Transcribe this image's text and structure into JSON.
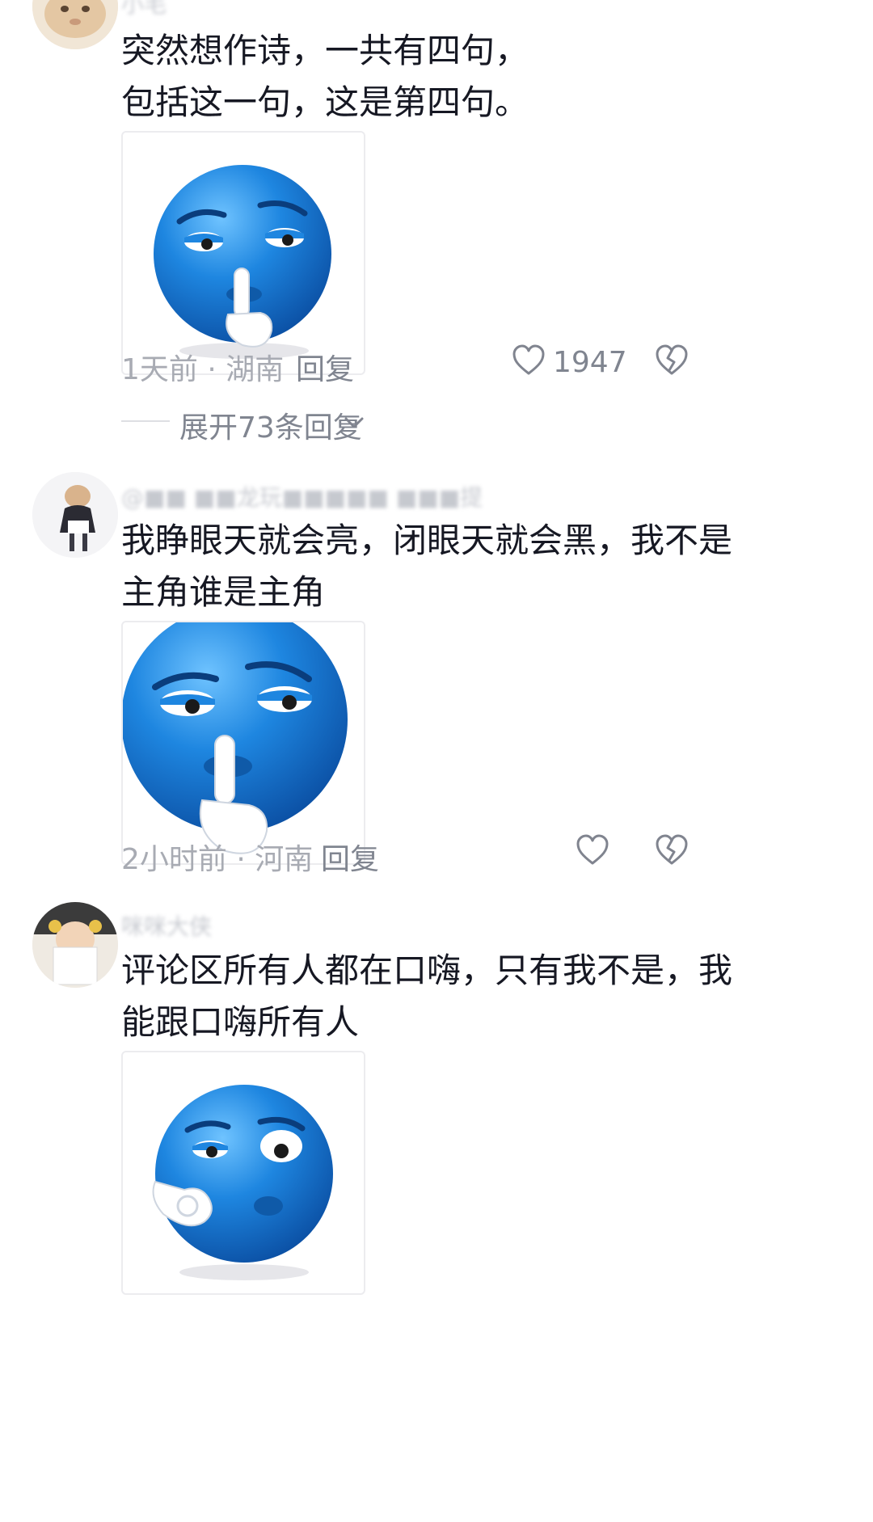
{
  "comments": [
    {
      "username": "小毛",
      "text_lines": [
        "突然想作诗，一共有四句，",
        "包括这一句，这是第四句。"
      ],
      "time_location": "1天前 · 湖南",
      "reply_label": "回复",
      "like_count": "1947",
      "sticker": "shush-emoji",
      "expand_replies": "展开73条回复"
    },
    {
      "username": "@■■ ■■龙玩■■■■■ ■■■提",
      "text_lines": [
        "我睁眼天就会亮，闭眼天就会黑，我不是",
        "主角谁是主角"
      ],
      "time_location": "2小时前 · 河南",
      "reply_label": "回复",
      "like_count": "",
      "sticker": "shush-emoji"
    },
    {
      "username": "咪咪大侠",
      "text_lines": [
        "评论区所有人都在口嗨，只有我不是，我",
        "能跟口嗨所有人"
      ],
      "sticker": "ok-emoji"
    }
  ],
  "icons": {
    "like": "heart-outline-icon",
    "dislike": "broken-heart-icon",
    "expand": "chevron-down-icon"
  },
  "colors": {
    "emoji_blue": "#1e86e0",
    "meta_gray": "#a8abb3",
    "text": "#161823"
  }
}
